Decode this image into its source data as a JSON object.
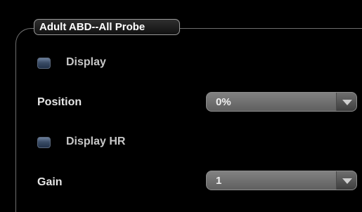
{
  "group": {
    "title": "Adult ABD--All Probe"
  },
  "display_checkbox": {
    "label": "Display",
    "checked": false
  },
  "position": {
    "label": "Position",
    "value": "0%"
  },
  "display_hr_checkbox": {
    "label": "Display HR",
    "checked": false
  },
  "gain": {
    "label": "Gain",
    "value": "1"
  },
  "icons": {
    "dropdown": "chevron-down-icon"
  },
  "colors": {
    "background": "#000000",
    "checkbox": "#3a4c66",
    "select": "#6e6e6e"
  }
}
